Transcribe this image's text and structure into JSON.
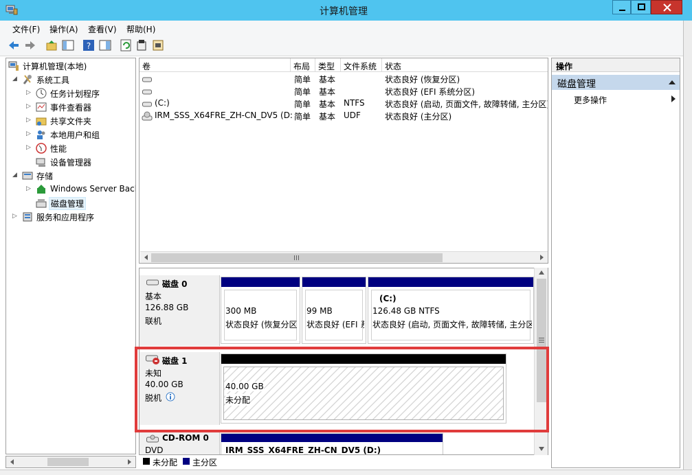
{
  "window": {
    "title": "计算机管理"
  },
  "menu": [
    {
      "label": "文件(F)"
    },
    {
      "label": "操作(A)"
    },
    {
      "label": "查看(V)"
    },
    {
      "label": "帮助(H)"
    }
  ],
  "toolbar": {
    "icons": [
      "back-icon",
      "forward-icon",
      "up-folder-icon",
      "show-hide-tree-icon",
      "help-icon",
      "properties-view-icon",
      "refresh-icon",
      "settings-icon",
      "export-icon"
    ]
  },
  "tree": {
    "items": [
      {
        "label": "计算机管理(本地)",
        "arrow": "",
        "level": 0
      },
      {
        "label": "系统工具",
        "arrow": "◢",
        "level": 1
      },
      {
        "label": "任务计划程序",
        "arrow": "▷",
        "level": 2
      },
      {
        "label": "事件查看器",
        "arrow": "▷",
        "level": 2
      },
      {
        "label": "共享文件夹",
        "arrow": "▷",
        "level": 2
      },
      {
        "label": "本地用户和组",
        "arrow": "▷",
        "level": 2
      },
      {
        "label": "性能",
        "arrow": "▷",
        "level": 2
      },
      {
        "label": "设备管理器",
        "arrow": "",
        "level": 2
      },
      {
        "label": "存储",
        "arrow": "◢",
        "level": 1
      },
      {
        "label": "Windows Server Back",
        "arrow": "▷",
        "level": 2
      },
      {
        "label": "磁盘管理",
        "arrow": "",
        "level": 2,
        "selected": true
      },
      {
        "label": "服务和应用程序",
        "arrow": "▷",
        "level": 1
      }
    ]
  },
  "volumes": {
    "columns": [
      "卷",
      "布局",
      "类型",
      "文件系统",
      "状态"
    ],
    "rows": [
      {
        "name": "",
        "layout": "简单",
        "type": "基本",
        "fs": "",
        "status": "状态良好 (恢复分区)"
      },
      {
        "name": "",
        "layout": "简单",
        "type": "基本",
        "fs": "",
        "status": "状态良好 (EFI 系统分区)"
      },
      {
        "name": "(C:)",
        "layout": "简单",
        "type": "基本",
        "fs": "NTFS",
        "status": "状态良好 (启动, 页面文件, 故障转储, 主分区)"
      },
      {
        "name": "IRM_SSS_X64FRE_ZH-CN_DV5 (D:)",
        "layout": "简单",
        "type": "基本",
        "fs": "UDF",
        "status": "状态良好 (主分区)"
      }
    ]
  },
  "disks": {
    "disk0": {
      "name": "磁盘 0",
      "type": "基本",
      "size": "126.88 GB",
      "state": "联机",
      "partitions": [
        {
          "label": "",
          "size": "300 MB",
          "status": "状态良好 (恢复分区"
        },
        {
          "label": "",
          "size": "99 MB",
          "status": "状态良好 (EFI 系"
        },
        {
          "label": "(C:)",
          "size": "126.48 GB NTFS",
          "status": "状态良好 (启动, 页面文件, 故障转储, 主分区"
        }
      ]
    },
    "disk1": {
      "name": "磁盘 1",
      "type": "未知",
      "size": "40.00 GB",
      "state": "脱机",
      "partitions": [
        {
          "size": "40.00 GB",
          "status": "未分配"
        }
      ]
    },
    "cdrom0": {
      "name": "CD-ROM 0",
      "type": "DVD",
      "partitions": [
        {
          "label": "IRM_SSS_X64FRE_ZH-CN_DV5  (D:)"
        }
      ]
    }
  },
  "legend": [
    {
      "label": "未分配",
      "color": "#000000"
    },
    {
      "label": "主分区",
      "color": "#000080"
    }
  ],
  "actions": {
    "header": "操作",
    "group": "磁盘管理",
    "more": "更多操作"
  },
  "colors": {
    "titlebar": "#4fc4ef",
    "partition_bar_primary": "#000080",
    "partition_bar_unallocated": "#000000",
    "highlight": "#e03c3c",
    "actions_group": "#c5d8ec"
  }
}
